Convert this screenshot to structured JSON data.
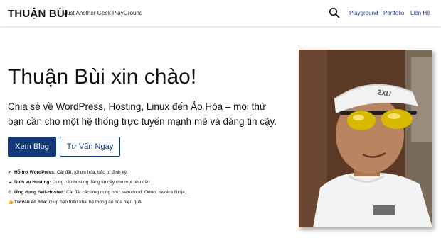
{
  "header": {
    "logo": "THUẬN BÙI",
    "tagline": "Just Another Geek PlayGround",
    "nav": [
      "Playground",
      "Portfolio",
      "Liên Hệ"
    ]
  },
  "hero": {
    "title": "Thuận Bùi xin chào!",
    "description": "Chia sẻ về WordPress, Hosting, Linux đến Ảo Hóa – mọi thứ bạn cần cho một hệ thống trực tuyến mạnh mẽ và đáng tin cậy.",
    "primary_button": "Xem Blog",
    "secondary_button": "Tư Vấn Ngay"
  },
  "features": [
    {
      "icon": "wrench-icon",
      "glyph": "✔",
      "title": "Hỗ trợ WordPress:",
      "text": "Cài đặt, tối ưu hóa, bảo trì định kỳ."
    },
    {
      "icon": "cloud-icon",
      "glyph": "☁",
      "title": "Dịch vụ Hosting:",
      "text": "Cung cấp hosting đáng tin cậy cho mọi nhu cầu."
    },
    {
      "icon": "gear-icon",
      "glyph": "⚙",
      "title": "Ứng dụng Self-Hosted:",
      "text": "Cài đặt các ứng dụng như Nextcloud, Odoo, Invoice Ninja,..."
    },
    {
      "icon": "thumbs-up-icon",
      "glyph": "👍",
      "title": "Tư vấn ảo hóa:",
      "text": "Giúp bạn triển khai hệ thống ảo hóa hiệu quả."
    }
  ],
  "photo": {
    "visor_text": "2XU",
    "colors": {
      "background": "#5a3a26",
      "visor": "#f2f2f2",
      "lens": "#d8b800",
      "skin": "#b98560",
      "shirt": "#f4f4f4"
    }
  }
}
